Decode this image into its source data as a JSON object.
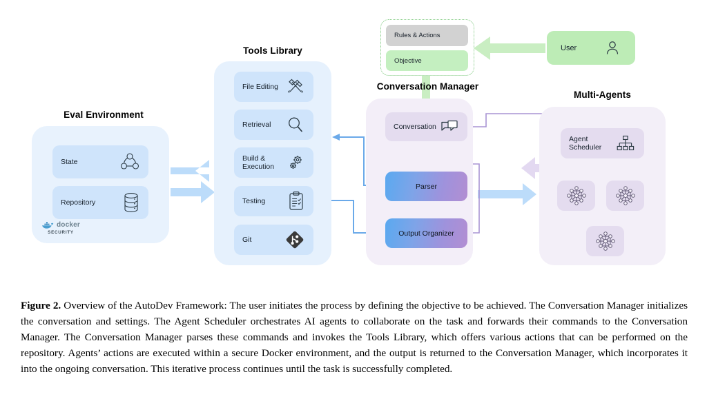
{
  "figure": {
    "label": "Figure 2.",
    "caption": " Overview of the AutoDev Framework: The user initiates the process by defining the objective to be achieved. The Conversation Manager initializes the conversation and settings. The Agent Scheduler orchestrates AI agents to collaborate on the task and forwards their commands to the Conversation Manager. The Conversation Manager parses these commands and invokes the Tools Library, which offers various actions that can be performed on the repository. Agents’ actions are executed within a secure Docker environment, and the output is returned to the Conversation Manager, which incorporates it into the ongoing conversation. This iterative process continues until the task is successfully completed."
  },
  "sections": {
    "eval_environment": {
      "title": "Eval Environment",
      "items": [
        {
          "label": "State",
          "icon": "state-graph-icon"
        },
        {
          "label": "Repository",
          "icon": "database-icon"
        }
      ],
      "badge": {
        "name": "docker",
        "sub": "SECURITY",
        "icon": "docker-whale-icon"
      }
    },
    "tools_library": {
      "title": "Tools Library",
      "items": [
        {
          "label": "File Editing",
          "icon": "hammer-wrench-icon"
        },
        {
          "label": "Retrieval",
          "icon": "magnifier-icon"
        },
        {
          "label": "Build &\nExecution",
          "icon": "gears-icon"
        },
        {
          "label": "Testing",
          "icon": "clipboard-check-icon"
        },
        {
          "label": "Git",
          "icon": "git-logo-icon"
        }
      ]
    },
    "conversation_manager": {
      "title": "Conversation Manager",
      "items": [
        {
          "label": "Conversation",
          "icon": "chat-bubbles-icon"
        },
        {
          "label": "Parser",
          "icon": ""
        },
        {
          "label": "Output Organizer",
          "icon": ""
        }
      ]
    },
    "multi_agents": {
      "title": "Multi-Agents",
      "scheduler": {
        "label": "Agent\nScheduler",
        "icon": "org-chart-icon"
      },
      "agents": [
        {
          "icon": "neural-network-icon"
        },
        {
          "icon": "neural-network-icon"
        },
        {
          "icon": "neural-network-icon"
        }
      ]
    },
    "settings_group": {
      "items": [
        {
          "label": "Rules & Actions",
          "style": "grey"
        },
        {
          "label": "Objective",
          "style": "green"
        }
      ]
    },
    "user": {
      "label": "User",
      "icon": "person-icon"
    }
  },
  "colors": {
    "panel_blue": "#e8f2fd",
    "card_blue": "#cfe4fb",
    "panel_purple": "#f3eef8",
    "card_lilac": "#e4dcef",
    "green": "#bdecb6",
    "grey_chip": "#d2d2d2",
    "arrow_blue": "#bcdcfa",
    "arrow_line_blue": "#6aa9e9",
    "arrow_purple": "#a894d4",
    "arrow_purple_fill": "#ded2ee",
    "arrow_green": "#c9eec2"
  }
}
